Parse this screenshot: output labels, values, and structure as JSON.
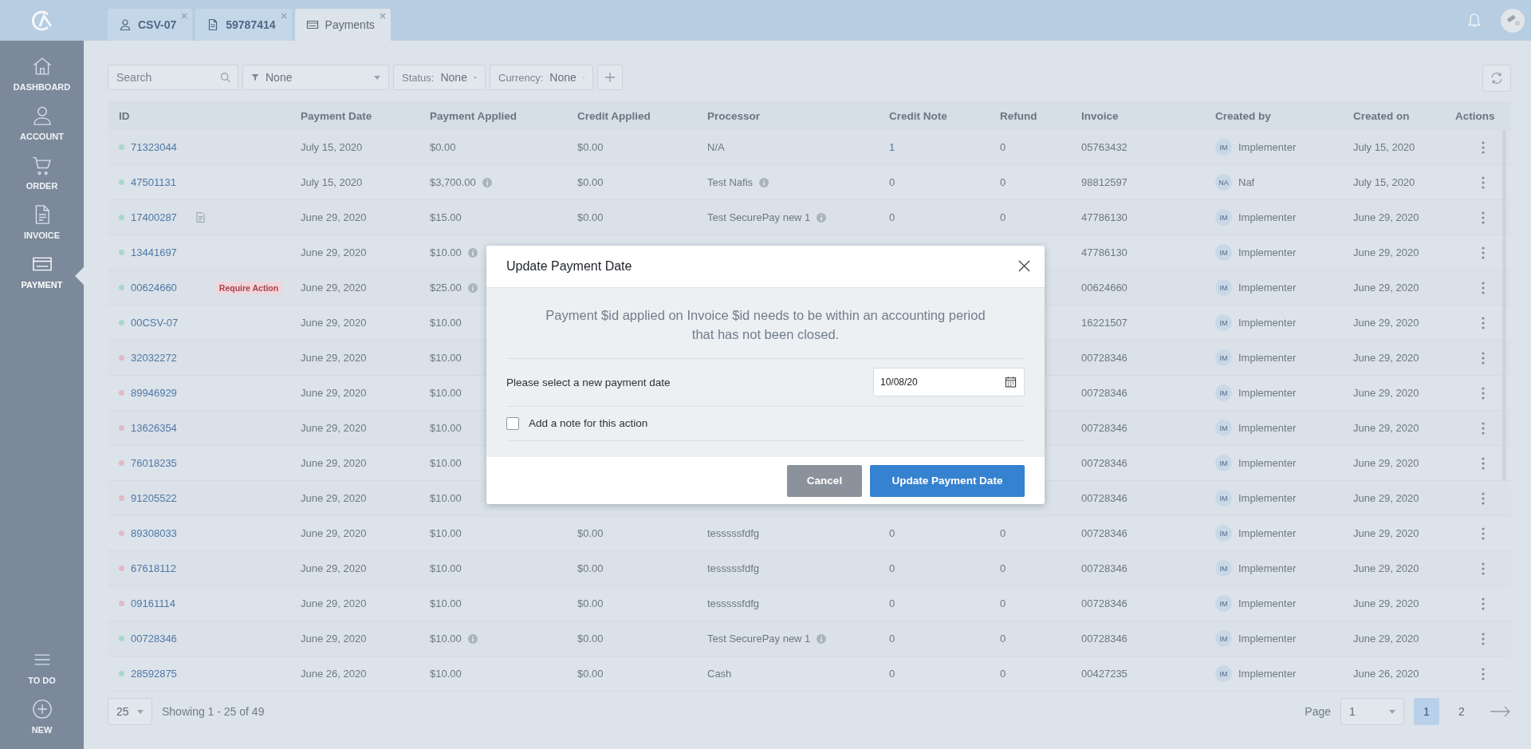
{
  "tabs": [
    {
      "label": "CSV-07",
      "selected": false
    },
    {
      "label": "59787414",
      "selected": false
    },
    {
      "label": "Payments",
      "selected": true
    }
  ],
  "sidebar": {
    "items": [
      {
        "label": "DASHBOARD",
        "selected": false
      },
      {
        "label": "ACCOUNT",
        "selected": false
      },
      {
        "label": "ORDER",
        "selected": false
      },
      {
        "label": "INVOICE",
        "selected": false
      },
      {
        "label": "PAYMENT",
        "selected": true
      }
    ],
    "bottom_items": [
      {
        "label": "TO DO",
        "selected": false
      },
      {
        "label": "NEW",
        "selected": false
      }
    ]
  },
  "toolbar": {
    "search": {
      "placeholder": "Search"
    },
    "filter": {
      "value": "None"
    },
    "status": {
      "label": "Status:",
      "value": "None"
    },
    "currency": {
      "label": "Currency:",
      "value": "None"
    }
  },
  "table": {
    "columns": [
      "ID",
      "Payment Date",
      "Payment Applied",
      "Credit Applied",
      "Processor",
      "Credit Note",
      "Refund",
      "Invoice",
      "Created by",
      "Created on",
      "Actions"
    ],
    "rows": [
      {
        "id": "71323044",
        "color": "#a8d8c8",
        "doc": false,
        "payment_date": "July 15, 2020",
        "payment_applied": "$0.00",
        "payment_info": false,
        "credit_applied": "$0.00",
        "processor": "N/A",
        "processor_info": false,
        "credit_note": "1",
        "credit_note_link": true,
        "refund": "0",
        "invoice": "05763432",
        "initials": "IM",
        "created_by": "Implementer",
        "created_on": "July 15, 2020"
      },
      {
        "id": "47501131",
        "color": "#a8d8c8",
        "doc": false,
        "payment_date": "July 15, 2020",
        "payment_applied": "$3,700.00",
        "payment_info": true,
        "credit_applied": "$0.00",
        "processor": "Test Nafis",
        "processor_info": true,
        "credit_note": "0",
        "credit_note_link": false,
        "refund": "0",
        "invoice": "98812597",
        "initials": "NA",
        "created_by": "Naf",
        "created_on": "July 15, 2020"
      },
      {
        "id": "17400287",
        "color": "#a8d8c8",
        "doc": true,
        "payment_date": "June 29, 2020",
        "payment_applied": "$15.00",
        "payment_info": false,
        "credit_applied": "$0.00",
        "processor": "Test SecurePay new 1",
        "processor_info": true,
        "credit_note": "0",
        "credit_note_link": false,
        "refund": "0",
        "invoice": "47786130",
        "initials": "IM",
        "created_by": "Implementer",
        "created_on": "June 29, 2020"
      },
      {
        "id": "13441697",
        "color": "#a8d8c8",
        "doc": false,
        "payment_date": "June 29, 2020",
        "payment_applied": "$10.00",
        "payment_info": true,
        "invoice": "47786130",
        "initials": "IM",
        "created_by": "Implementer",
        "created_on": "June 29, 2020"
      },
      {
        "id": "00624660",
        "color": "#a8d8c8",
        "doc": false,
        "badge": "Require Action",
        "payment_date": "June 29, 2020",
        "payment_applied": "$25.00",
        "payment_info": true,
        "invoice": "00624660",
        "initials": "IM",
        "created_by": "Implementer",
        "created_on": "June 29, 2020"
      },
      {
        "id": "00CSV-07",
        "color": "#a8d8c8",
        "doc": false,
        "payment_date": "June 29, 2020",
        "payment_applied": "$10.00",
        "payment_info": false,
        "invoice": "16221507",
        "initials": "IM",
        "created_by": "Implementer",
        "created_on": "June 29, 2020"
      },
      {
        "id": "32032272",
        "color": "#e3b9c3",
        "doc": false,
        "payment_date": "June 29, 2020",
        "payment_applied": "$10.00",
        "payment_info": false,
        "invoice": "00728346",
        "initials": "IM",
        "created_by": "Implementer",
        "created_on": "June 29, 2020"
      },
      {
        "id": "89946929",
        "color": "#e3b9c3",
        "doc": false,
        "payment_date": "June 29, 2020",
        "payment_applied": "$10.00",
        "payment_info": false,
        "invoice": "00728346",
        "initials": "IM",
        "created_by": "Implementer",
        "created_on": "June 29, 2020"
      },
      {
        "id": "13626354",
        "color": "#e3b9c3",
        "doc": false,
        "payment_date": "June 29, 2020",
        "payment_applied": "$10.00",
        "payment_info": false,
        "invoice": "00728346",
        "initials": "IM",
        "created_by": "Implementer",
        "created_on": "June 29, 2020"
      },
      {
        "id": "76018235",
        "color": "#e3b9c3",
        "doc": false,
        "payment_date": "June 29, 2020",
        "payment_applied": "$10.00",
        "payment_info": false,
        "invoice": "00728346",
        "initials": "IM",
        "created_by": "Implementer",
        "created_on": "June 29, 2020"
      },
      {
        "id": "91205522",
        "color": "#e3b9c3",
        "doc": false,
        "payment_date": "June 29, 2020",
        "payment_applied": "$10.00",
        "payment_info": false,
        "invoice": "00728346",
        "initials": "IM",
        "created_by": "Implementer",
        "created_on": "June 29, 2020"
      },
      {
        "id": "89308033",
        "color": "#e3b9c3",
        "doc": false,
        "payment_date": "June 29, 2020",
        "payment_applied": "$10.00",
        "payment_info": false,
        "credit_applied": "$0.00",
        "processor": "tesssssfdfg",
        "processor_info": false,
        "credit_note": "0",
        "credit_note_link": false,
        "refund": "0",
        "invoice": "00728346",
        "initials": "IM",
        "created_by": "Implementer",
        "created_on": "June 29, 2020"
      },
      {
        "id": "67618112",
        "color": "#e3b9c3",
        "doc": false,
        "payment_date": "June 29, 2020",
        "payment_applied": "$10.00",
        "payment_info": false,
        "credit_applied": "$0.00",
        "processor": "tesssssfdfg",
        "processor_info": false,
        "credit_note": "0",
        "credit_note_link": false,
        "refund": "0",
        "invoice": "00728346",
        "initials": "IM",
        "created_by": "Implementer",
        "created_on": "June 29, 2020"
      },
      {
        "id": "09161114",
        "color": "#e3b9c3",
        "doc": false,
        "payment_date": "June 29, 2020",
        "payment_applied": "$10.00",
        "payment_info": false,
        "credit_applied": "$0.00",
        "processor": "tesssssfdfg",
        "processor_info": false,
        "credit_note": "0",
        "credit_note_link": false,
        "refund": "0",
        "invoice": "00728346",
        "initials": "IM",
        "created_by": "Implementer",
        "created_on": "June 29, 2020"
      },
      {
        "id": "00728346",
        "color": "#a8d8c8",
        "doc": false,
        "payment_date": "June 29, 2020",
        "payment_applied": "$10.00",
        "payment_info": true,
        "credit_applied": "$0.00",
        "processor": "Test SecurePay new 1",
        "processor_info": true,
        "credit_note": "0",
        "credit_note_link": false,
        "refund": "0",
        "invoice": "00728346",
        "initials": "IM",
        "created_by": "Implementer",
        "created_on": "June 29, 2020"
      },
      {
        "id": "28592875",
        "color": "#a8d8c8",
        "doc": false,
        "payment_date": "June 26, 2020",
        "payment_applied": "$10.00",
        "payment_info": false,
        "credit_applied": "$0.00",
        "processor": "Cash",
        "processor_info": false,
        "credit_note": "0",
        "credit_note_link": false,
        "refund": "0",
        "invoice": "00427235",
        "initials": "IM",
        "created_by": "Implementer",
        "created_on": "June 26, 2020"
      }
    ]
  },
  "pagination": {
    "page_size": "25",
    "summary": "Showing 1 - 25 of 49",
    "page_label": "Page",
    "page_select": "1",
    "pages": [
      {
        "label": "1",
        "selected": true
      },
      {
        "label": "2",
        "selected": false
      }
    ]
  },
  "modal": {
    "title": "Update Payment Date",
    "message": "Payment $id applied on Invoice $id needs to be within an accounting period that has not been closed.",
    "date_label": "Please select a new payment date",
    "date_value": "10/08/20",
    "note": {
      "label": "Add a note for this action",
      "checked": false
    },
    "buttons": [
      {
        "label": "Cancel",
        "kind": "secondary"
      },
      {
        "label": "Update Payment Date",
        "kind": "primary"
      }
    ]
  }
}
